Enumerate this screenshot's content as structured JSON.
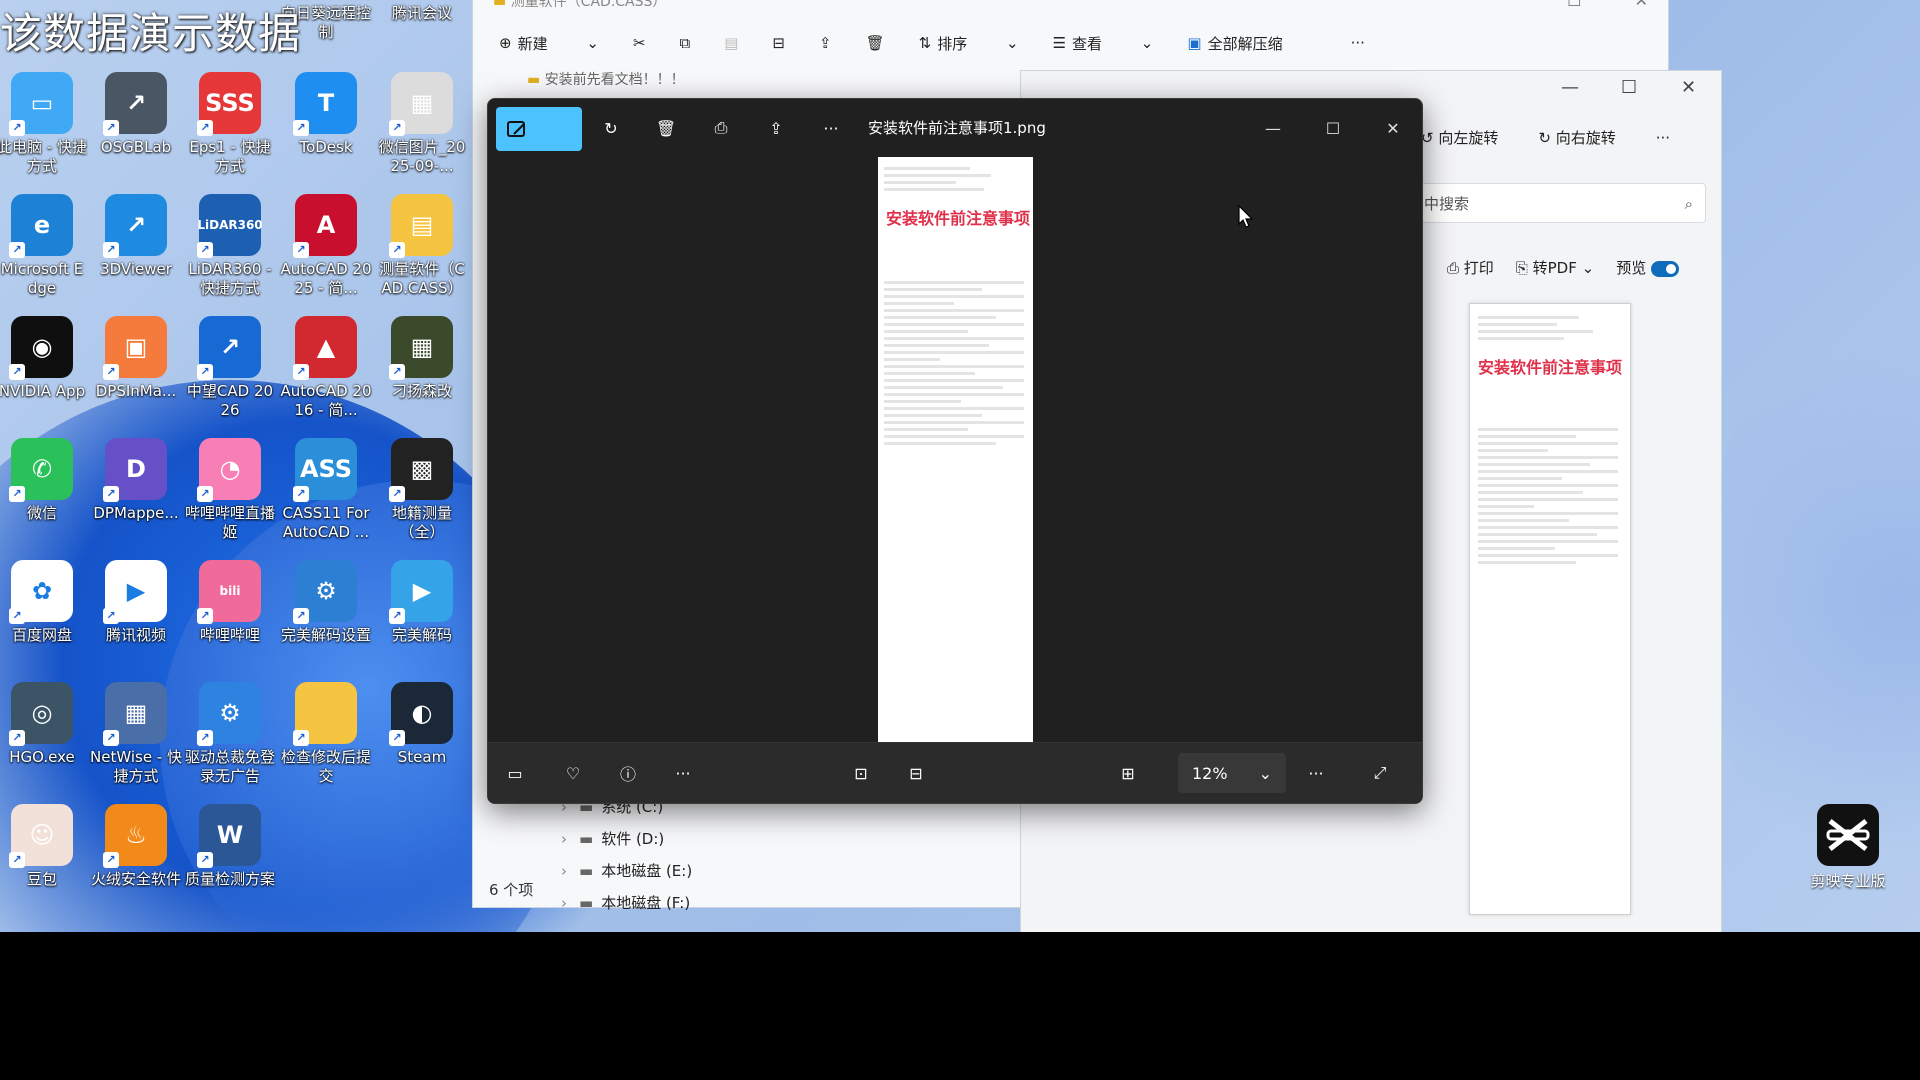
{
  "watermark": "该数据演示数据",
  "desktop": {
    "top_labels": [
      "大",
      "",
      "",
      "向日葵远程控制",
      "腾讯会议"
    ],
    "icons": [
      {
        "label": "此电脑 - 快捷方式",
        "color": "#3fa9f5",
        "glyph": "▭"
      },
      {
        "label": "OSGBLab",
        "color": "#4a5664",
        "glyph": "↗"
      },
      {
        "label": "Eps1 - 快捷方式",
        "color": "#e63838",
        "glyph": "SSS"
      },
      {
        "label": "ToDesk",
        "color": "#1f8ef1",
        "glyph": "T"
      },
      {
        "label": "微信图片_2025-09-...",
        "color": "#dcdcdc",
        "glyph": "▦"
      },
      {
        "label": "Microsoft Edge",
        "color": "#1d82d6",
        "glyph": "e"
      },
      {
        "label": "3DViewer",
        "color": "#1e8be0",
        "glyph": "↗"
      },
      {
        "label": "LiDAR360 - 快捷方式",
        "color": "#1d5fb0",
        "glyph": "LiDAR360"
      },
      {
        "label": "AutoCAD 2025 - 简...",
        "color": "#c8102e",
        "glyph": "A"
      },
      {
        "label": "测量软件（CAD.CASS）",
        "color": "#f5c542",
        "glyph": "▤"
      },
      {
        "label": "NVIDIA App",
        "color": "#0f0f0f",
        "glyph": "◉"
      },
      {
        "label": "DPSInMa...",
        "color": "#f47b3c",
        "glyph": "▣"
      },
      {
        "label": "中望CAD 2026",
        "color": "#1769d4",
        "glyph": "↗"
      },
      {
        "label": "AutoCAD 2016 - 简...",
        "color": "#d22830",
        "glyph": "▲"
      },
      {
        "label": "刁扬森改",
        "color": "#3a4a2a",
        "glyph": "▦"
      },
      {
        "label": "微信",
        "color": "#2ac05a",
        "glyph": "✆"
      },
      {
        "label": "DPMappe...",
        "color": "#6650c8",
        "glyph": "D"
      },
      {
        "label": "哔哩哔哩直播姬",
        "color": "#f87fb5",
        "glyph": "◔"
      },
      {
        "label": "CASS11 For AutoCAD ...",
        "color": "#2a8fd8",
        "glyph": "ASS"
      },
      {
        "label": "地籍测量（全）",
        "color": "#222",
        "glyph": "▩"
      },
      {
        "label": "百度网盘",
        "color": "#ffffff",
        "glyph": "✿"
      },
      {
        "label": "腾讯视频",
        "color": "#ffffff",
        "glyph": "▶"
      },
      {
        "label": "哔哩哔哩",
        "color": "#f06a9a",
        "glyph": "bili"
      },
      {
        "label": "完美解码设置",
        "color": "#2c7fd3",
        "glyph": "⚙"
      },
      {
        "label": "完美解码",
        "color": "#35a3e8",
        "glyph": "▶"
      },
      {
        "label": "HGO.exe",
        "color": "#3b5566",
        "glyph": "◎"
      },
      {
        "label": "NetWise - 快捷方式",
        "color": "#4a6ea8",
        "glyph": "▦"
      },
      {
        "label": "驱动总裁免登录无广告",
        "color": "#2f83e0",
        "glyph": "⚙"
      },
      {
        "label": "检查修改后提交",
        "color": "#f5c542",
        "glyph": ""
      },
      {
        "label": "Steam",
        "color": "#1b2838",
        "glyph": "◐"
      },
      {
        "label": "豆包",
        "color": "#f2e1d8",
        "glyph": "☺"
      },
      {
        "label": "火绒安全软件",
        "color": "#f28a1a",
        "glyph": "♨"
      },
      {
        "label": "质量检测方案",
        "color": "#2b5797",
        "glyph": "W"
      }
    ],
    "capcut_label": "剪映专业版"
  },
  "explorer": {
    "title": "测量软件（CAD.CASS）",
    "toolbar": {
      "new": "新建",
      "sort": "排序",
      "view": "查看",
      "extract": "全部解压缩",
      "more": "···"
    },
    "address": "安装前先看文档！！！",
    "nav": [
      {
        "label": "系统 (C:)",
        "icon": "drive-c-icon"
      },
      {
        "label": "软件 (D:)",
        "icon": "drive-icon"
      },
      {
        "label": "本地磁盘 (E:)",
        "icon": "drive-icon"
      },
      {
        "label": "本地磁盘 (F:)",
        "icon": "drive-icon"
      }
    ],
    "count": "6 个项"
  },
  "preview_window": {
    "rotate_left": "向左旋转",
    "rotate_right": "向右旋转",
    "more": "···",
    "search_placeholder": "中搜索",
    "print": "打印",
    "to_pdf": "转PDF",
    "preview": "预览",
    "thumb_caption": "安装软件前注意事项"
  },
  "photos": {
    "filename": "安装软件前注意事项1.png",
    "zoom": "12%",
    "image_caption": "安装软件前注意事项",
    "more": "···"
  }
}
